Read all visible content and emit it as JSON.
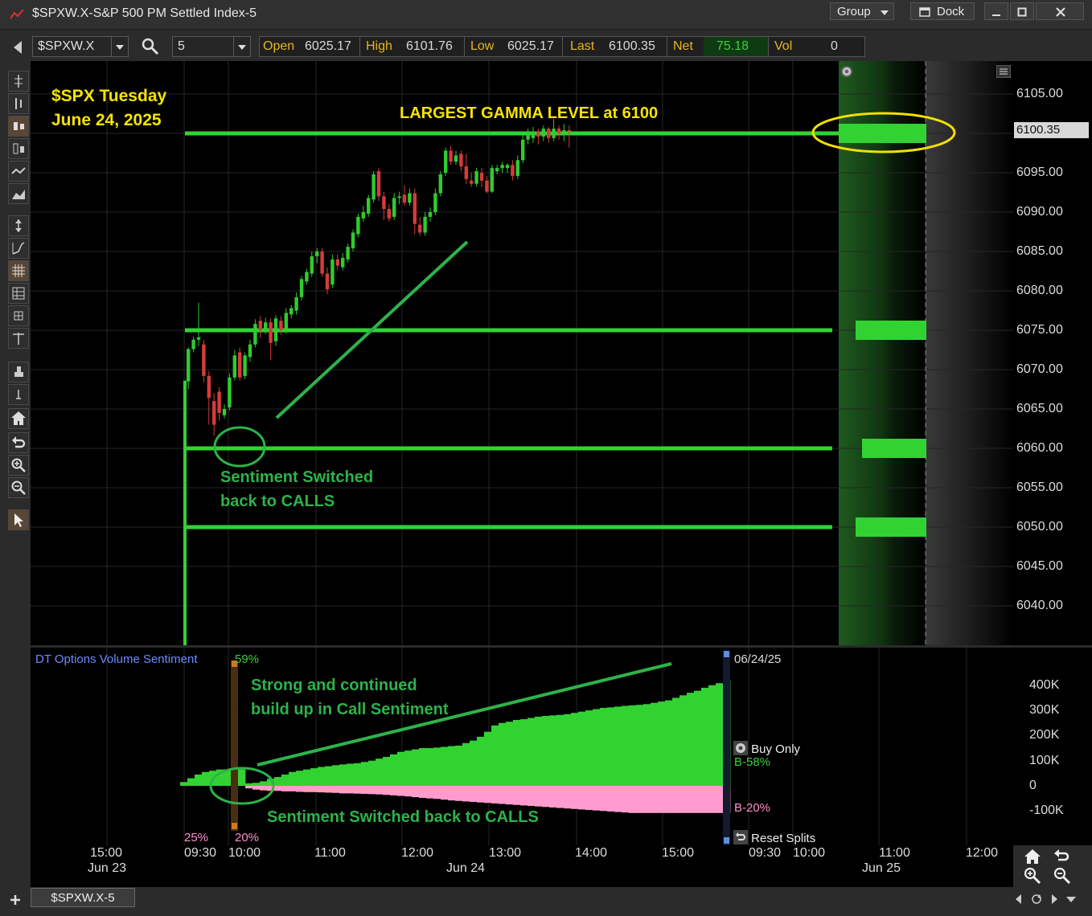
{
  "window": {
    "title": "$SPXW.X-S&P 500 PM Settled Index-5",
    "group_label": "Group",
    "dock_label": "Dock"
  },
  "toolbar": {
    "symbol": "$SPXW.X",
    "interval": "5"
  },
  "quote": {
    "open_label": "Open",
    "open": "6025.17",
    "high_label": "High",
    "high": "6101.76",
    "low_label": "Low",
    "low": "6025.17",
    "last_label": "Last",
    "last": "6100.35",
    "net_label": "Net",
    "net": "75.18",
    "vol_label": "Vol",
    "vol": "0"
  },
  "annotations": {
    "title_line1": "$SPX Tuesday",
    "title_line2": "June 24, 2025",
    "gamma": "LARGEST GAMMA LEVEL at 6100",
    "switch1_line1": "Sentiment Switched",
    "switch1_line2": "back to CALLS",
    "build_line1": "Strong and continued",
    "build_line2": "build up in Call Sentiment",
    "switch2": "Sentiment Switched back to CALLS"
  },
  "price_axis": {
    "labels": [
      "6105.00",
      "6100.00",
      "6095.00",
      "6090.00",
      "6085.00",
      "6080.00",
      "6075.00",
      "6070.00",
      "6065.00",
      "6060.00",
      "6055.00",
      "6050.00",
      "6045.00",
      "6040.00"
    ],
    "last_tag": "6100.35"
  },
  "gamma_levels": [
    6100,
    6075,
    6060,
    6050
  ],
  "sentiment": {
    "title": "DT Options Volume Sentiment",
    "pct_top": "59%",
    "pct_left": "25%",
    "pct_bottom": "20%",
    "date": "06/24/25",
    "buy_only": "Buy Only",
    "b_call": "B-58%",
    "b_put": "B-20%",
    "reset": "Reset Splits",
    "axis_labels": [
      "400K",
      "300K",
      "200K",
      "100K",
      "0",
      "-100K"
    ]
  },
  "time_axis": {
    "times": [
      "15:00",
      "09:30",
      "10:00",
      "11:00",
      "12:00",
      "13:00",
      "14:00",
      "15:00",
      "09:30",
      "10:00",
      "11:00",
      "12:00"
    ],
    "dates": [
      "Jun 23",
      "Jun 24",
      "Jun 25"
    ]
  },
  "chart_data": {
    "type": "candlestick",
    "title": "$SPX Tuesday June 24, 2025",
    "ylim": [
      6035,
      6107
    ],
    "last": 6100.35,
    "candles": [
      [
        6068.5,
        6072.6,
        6067.5,
        6072.8
      ],
      [
        6072.6,
        6073.8,
        6072.2,
        6074.2
      ],
      [
        6073.8,
        6074.1,
        6073.0,
        6078.5
      ],
      [
        6073.2,
        6069.2,
        6068.4,
        6073.8
      ],
      [
        6069.2,
        6066.4,
        6063.0,
        6069.8
      ],
      [
        6066.0,
        6063.0,
        6061.6,
        6067.0
      ],
      [
        6067.2,
        6064.5,
        6063.5,
        6067.8
      ],
      [
        6064.2,
        6065.0,
        6063.8,
        6065.6
      ],
      [
        6065.2,
        6069.0,
        6064.8,
        6069.5
      ],
      [
        6069.0,
        6071.8,
        6068.6,
        6072.5
      ],
      [
        6072.2,
        6069.0,
        6068.6,
        6072.8
      ],
      [
        6069.2,
        6071.8,
        6068.8,
        6072.2
      ],
      [
        6071.6,
        6073.2,
        6071.0,
        6073.8
      ],
      [
        6073.2,
        6075.8,
        6072.8,
        6076.4
      ],
      [
        6076.2,
        6075.0,
        6074.0,
        6076.8
      ],
      [
        6075.0,
        6076.0,
        6074.5,
        6076.6
      ],
      [
        6076.0,
        6073.4,
        6071.2,
        6076.5
      ],
      [
        6073.6,
        6076.5,
        6073.0,
        6076.9
      ],
      [
        6076.2,
        6075.0,
        6074.4,
        6076.8
      ],
      [
        6075.0,
        6077.2,
        6074.6,
        6077.8
      ],
      [
        6077.0,
        6077.8,
        6076.5,
        6078.2
      ],
      [
        6077.5,
        6079.2,
        6077.0,
        6079.8
      ],
      [
        6079.2,
        6081.5,
        6078.8,
        6081.9
      ],
      [
        6081.2,
        6082.4,
        6080.8,
        6082.8
      ],
      [
        6082.2,
        6084.4,
        6081.8,
        6085.0
      ],
      [
        6084.4,
        6085.0,
        6083.5,
        6085.4
      ],
      [
        6085.0,
        6082.2,
        6081.8,
        6085.4
      ],
      [
        6082.2,
        6080.2,
        6079.6,
        6083.0
      ],
      [
        6080.8,
        6084.0,
        6080.4,
        6084.6
      ],
      [
        6084.0,
        6083.2,
        6082.6,
        6084.6
      ],
      [
        6083.0,
        6084.2,
        6082.6,
        6084.8
      ],
      [
        6084.0,
        6085.6,
        6083.6,
        6086.0
      ],
      [
        6085.4,
        6087.4,
        6085.0,
        6087.8
      ],
      [
        6087.2,
        6089.4,
        6086.8,
        6089.8
      ],
      [
        6089.2,
        6090.0,
        6088.8,
        6090.8
      ],
      [
        6089.8,
        6091.8,
        6089.4,
        6092.2
      ],
      [
        6091.6,
        6094.8,
        6091.2,
        6095.2
      ],
      [
        6095.2,
        6092.0,
        6091.4,
        6095.6
      ],
      [
        6092.0,
        6090.4,
        6089.0,
        6092.6
      ],
      [
        6090.4,
        6089.2,
        6088.8,
        6091.0
      ],
      [
        6089.4,
        6091.8,
        6089.0,
        6092.4
      ],
      [
        6091.8,
        6092.0,
        6091.0,
        6092.6
      ],
      [
        6092.2,
        6091.2,
        6090.8,
        6093.4
      ],
      [
        6091.2,
        6092.4,
        6090.8,
        6093.0
      ],
      [
        6092.4,
        6088.5,
        6087.2,
        6093.0
      ],
      [
        6088.4,
        6087.4,
        6087.0,
        6089.4
      ],
      [
        6087.4,
        6089.4,
        6087.0,
        6090.0
      ],
      [
        6089.4,
        6090.0,
        6088.8,
        6090.6
      ],
      [
        6090.0,
        6092.4,
        6089.6,
        6093.0
      ],
      [
        6092.4,
        6094.8,
        6092.0,
        6095.2
      ],
      [
        6095.0,
        6097.8,
        6094.6,
        6098.2
      ],
      [
        6097.8,
        6096.4,
        6096.0,
        6098.4
      ],
      [
        6096.4,
        6097.2,
        6096.0,
        6097.8
      ],
      [
        6097.4,
        6095.8,
        6095.2,
        6097.8
      ],
      [
        6095.8,
        6094.2,
        6093.6,
        6097.4
      ],
      [
        6094.0,
        6093.6,
        6093.2,
        6095.0
      ],
      [
        6093.6,
        6095.2,
        6093.2,
        6095.6
      ],
      [
        6095.0,
        6094.0,
        6093.2,
        6095.6
      ],
      [
        6094.0,
        6092.6,
        6092.4,
        6094.6
      ],
      [
        6092.6,
        6095.6,
        6092.4,
        6096.0
      ],
      [
        6095.2,
        6095.6,
        6094.8,
        6096.0
      ],
      [
        6095.6,
        6096.0,
        6095.0,
        6096.4
      ],
      [
        6095.6,
        6096.0,
        6095.0,
        6096.2
      ],
      [
        6096.0,
        6094.6,
        6094.0,
        6096.6
      ],
      [
        6094.6,
        6096.6,
        6094.2,
        6097.2
      ],
      [
        6096.6,
        6099.2,
        6096.2,
        6099.8
      ],
      [
        6099.2,
        6099.8,
        6098.6,
        6100.6
      ],
      [
        6099.4,
        6100.2,
        6098.8,
        6100.8
      ],
      [
        6100.2,
        6099.6,
        6098.6,
        6100.6
      ],
      [
        6099.6,
        6100.6,
        6099.0,
        6101.0
      ],
      [
        6100.6,
        6099.4,
        6098.8,
        6100.8
      ],
      [
        6099.4,
        6100.6,
        6099.0,
        6101.8
      ],
      [
        6100.6,
        6100.0,
        6099.2,
        6101.0
      ],
      [
        6100.2,
        6100.4,
        6099.0,
        6101.2
      ],
      [
        6100.4,
        6100.35,
        6098.2,
        6101.0
      ]
    ],
    "sentiment_calls_K": [
      15,
      30,
      45,
      55,
      60,
      65,
      65,
      65,
      65,
      10,
      12,
      18,
      28,
      35,
      45,
      55,
      60,
      65,
      70,
      75,
      78,
      82,
      85,
      88,
      90,
      95,
      100,
      108,
      115,
      125,
      135,
      140,
      145,
      150,
      150,
      152,
      155,
      158,
      160,
      170,
      180,
      195,
      215,
      240,
      250,
      255,
      262,
      265,
      270,
      275,
      278,
      280,
      282,
      285,
      290,
      295,
      300,
      305,
      310,
      312,
      315,
      318,
      320,
      322,
      325,
      330,
      335,
      340,
      350,
      360,
      370,
      378,
      390,
      400,
      408,
      420
    ],
    "sentiment_puts_K": [
      0,
      0,
      0,
      0,
      0,
      0,
      0,
      0,
      0,
      -10,
      -15,
      -18,
      -20,
      -20,
      -22,
      -22,
      -24,
      -25,
      -25,
      -26,
      -27,
      -28,
      -30,
      -30,
      -31,
      -32,
      -33,
      -34,
      -36,
      -38,
      -40,
      -42,
      -45,
      -48,
      -50,
      -52,
      -55,
      -58,
      -60,
      -62,
      -64,
      -66,
      -68,
      -70,
      -72,
      -74,
      -76,
      -78,
      -80,
      -82,
      -84,
      -86,
      -88,
      -90,
      -92,
      -94,
      -96,
      -98,
      -100,
      -102,
      -104,
      -106,
      -108,
      -108,
      -108,
      -108,
      -108,
      -108,
      -108,
      -108,
      -108,
      -108,
      -108,
      -108,
      -108,
      -108
    ]
  }
}
